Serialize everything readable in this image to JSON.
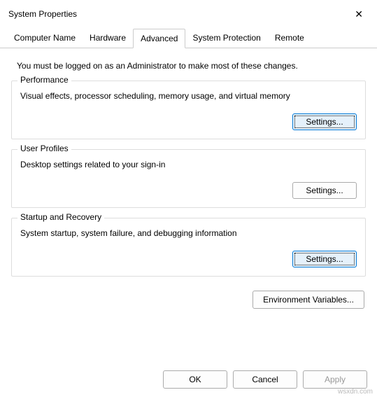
{
  "window": {
    "title": "System Properties",
    "close_glyph": "✕"
  },
  "tabs": {
    "computer_name": "Computer Name",
    "hardware": "Hardware",
    "advanced": "Advanced",
    "system_protection": "System Protection",
    "remote": "Remote",
    "active": "advanced"
  },
  "admin_note": "You must be logged on as an Administrator to make most of these changes.",
  "groups": {
    "performance": {
      "title": "Performance",
      "desc": "Visual effects, processor scheduling, memory usage, and virtual memory",
      "button": "Settings..."
    },
    "user_profiles": {
      "title": "User Profiles",
      "desc": "Desktop settings related to your sign-in",
      "button": "Settings..."
    },
    "startup_recovery": {
      "title": "Startup and Recovery",
      "desc": "System startup, system failure, and debugging information",
      "button": "Settings..."
    }
  },
  "env_button": "Environment Variables...",
  "actions": {
    "ok": "OK",
    "cancel": "Cancel",
    "apply": "Apply"
  },
  "watermark": "wsxdn.com"
}
